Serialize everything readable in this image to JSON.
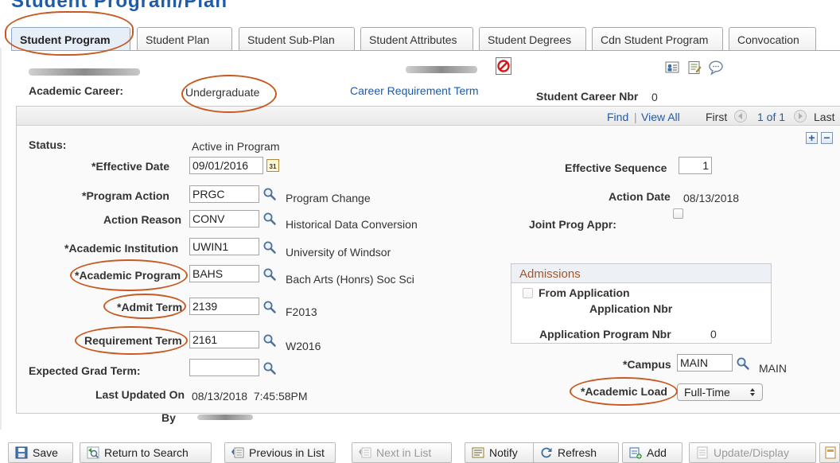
{
  "page_title": "Student Program/Plan",
  "tabs": [
    {
      "label": "Student Program",
      "active": true
    },
    {
      "label": "Student Plan"
    },
    {
      "label": "Student Sub-Plan"
    },
    {
      "label": "Student Attributes"
    },
    {
      "label": "Student Degrees"
    },
    {
      "label": "Cdn Student Program"
    },
    {
      "label": "Convocation"
    }
  ],
  "header": {
    "academic_career_label": "Academic Career:",
    "academic_career_value": "Undergraduate",
    "career_requirement_term_link": "Career Requirement Term",
    "student_career_nbr_label": "Student Career Nbr",
    "student_career_nbr_value": "0"
  },
  "nav": {
    "find": "Find",
    "separator": "|",
    "view_all": "View All",
    "first": "First",
    "range": "1 of 1",
    "last": "Last"
  },
  "form": {
    "status_label": "Status:",
    "status_value": "Active in Program",
    "effective_date_label": "*Effective Date",
    "effective_date_value": "09/01/2016",
    "effective_sequence_label": "Effective Sequence",
    "effective_sequence_value": "1",
    "program_action_label": "*Program Action",
    "program_action_value": "PRGC",
    "program_action_desc": "Program Change",
    "action_date_label": "Action Date",
    "action_date_value": "08/13/2018",
    "action_reason_label": "Action Reason",
    "action_reason_value": "CONV",
    "action_reason_desc": "Historical Data Conversion",
    "joint_prog_appr_label": "Joint Prog Appr:",
    "academic_institution_label": "*Academic Institution",
    "academic_institution_value": "UWIN1",
    "academic_institution_desc": "University of Windsor",
    "academic_program_label": "*Academic Program",
    "academic_program_value": "BAHS",
    "academic_program_desc": "Bach Arts (Honrs) Soc Sci",
    "admit_term_label": "*Admit Term",
    "admit_term_value": "2139",
    "admit_term_desc": "F2013",
    "requirement_term_label": "Requirement Term",
    "requirement_term_value": "2161",
    "requirement_term_desc": "W2016",
    "expected_grad_term_label": "Expected Grad Term:",
    "expected_grad_term_value": "",
    "campus_label": "*Campus",
    "campus_value": "MAIN",
    "campus_desc": "MAIN",
    "academic_load_label": "*Academic Load",
    "academic_load_value": "Full-Time",
    "last_updated_label": "Last Updated On",
    "last_updated_value": "08/13/2018  7:45:58PM",
    "by_label": "By",
    "calendar_glyph": "31"
  },
  "admissions": {
    "title": "Admissions",
    "from_application_label": "From Application",
    "application_nbr_label": "Application Nbr",
    "application_program_nbr_label": "Application Program Nbr",
    "application_program_nbr_value": "0"
  },
  "toolbar": {
    "save": "Save",
    "return_to_search": "Return to Search",
    "previous_in_list": "Previous in List",
    "next_in_list": "Next in List",
    "notify": "Notify",
    "refresh": "Refresh",
    "add": "Add",
    "update_display": "Update/Display"
  },
  "colors": {
    "link": "#1f5ba6",
    "annotation": "#c75a20",
    "section_header": "#a5542a"
  }
}
